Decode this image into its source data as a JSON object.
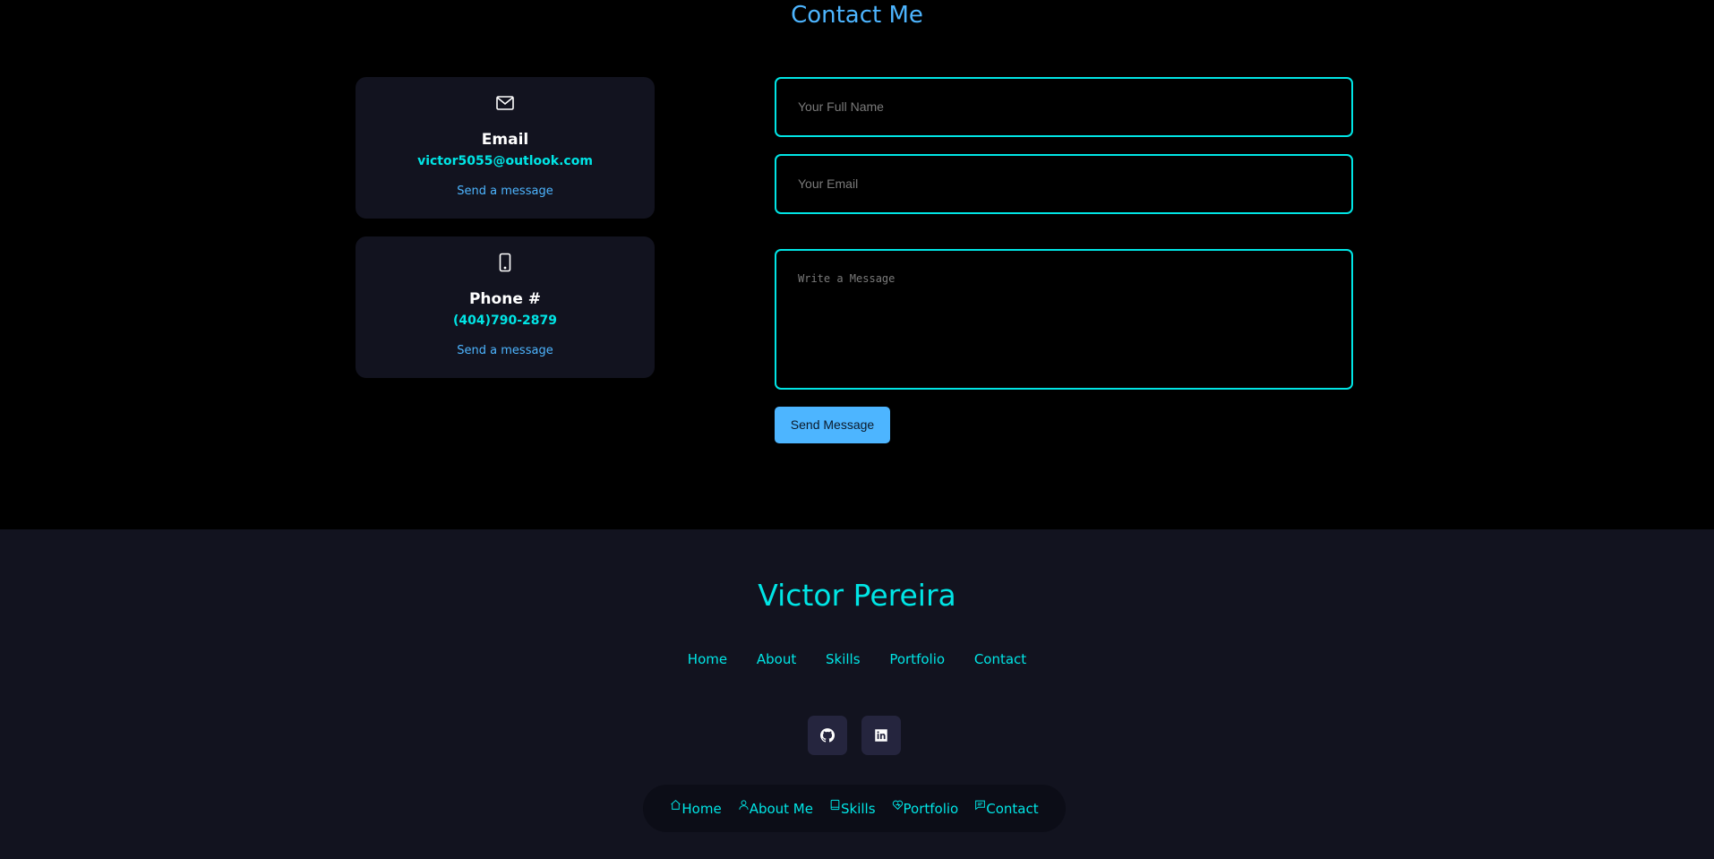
{
  "contact": {
    "title": "Contact Me",
    "email_card": {
      "title": "Email",
      "value": "victor5055@outlook.com",
      "link": "Send a message"
    },
    "phone_card": {
      "title": "Phone #",
      "value": "(404)790-2879",
      "link": "Send a message"
    },
    "form": {
      "name_placeholder": "Your Full Name",
      "email_placeholder": "Your Email",
      "message_placeholder": "Write a Message",
      "send_label": "Send Message"
    }
  },
  "footer": {
    "name": "Victor Pereira",
    "nav": [
      "Home",
      "About",
      "Skills",
      "Portfolio",
      "Contact"
    ],
    "social": [
      "github-icon",
      "linkedin-icon"
    ]
  },
  "bottom_nav": [
    {
      "label": "Home",
      "icon": "home-icon"
    },
    {
      "label": "About Me",
      "icon": "user-icon"
    },
    {
      "label": "Skills",
      "icon": "book-icon"
    },
    {
      "label": "Portfolio",
      "icon": "briefcase-icon"
    },
    {
      "label": "Contact",
      "icon": "message-icon"
    }
  ],
  "colors": {
    "accent": "#00e5e5",
    "link": "#4db5ff",
    "card_bg": "#12131f",
    "page_bg": "#000000"
  }
}
